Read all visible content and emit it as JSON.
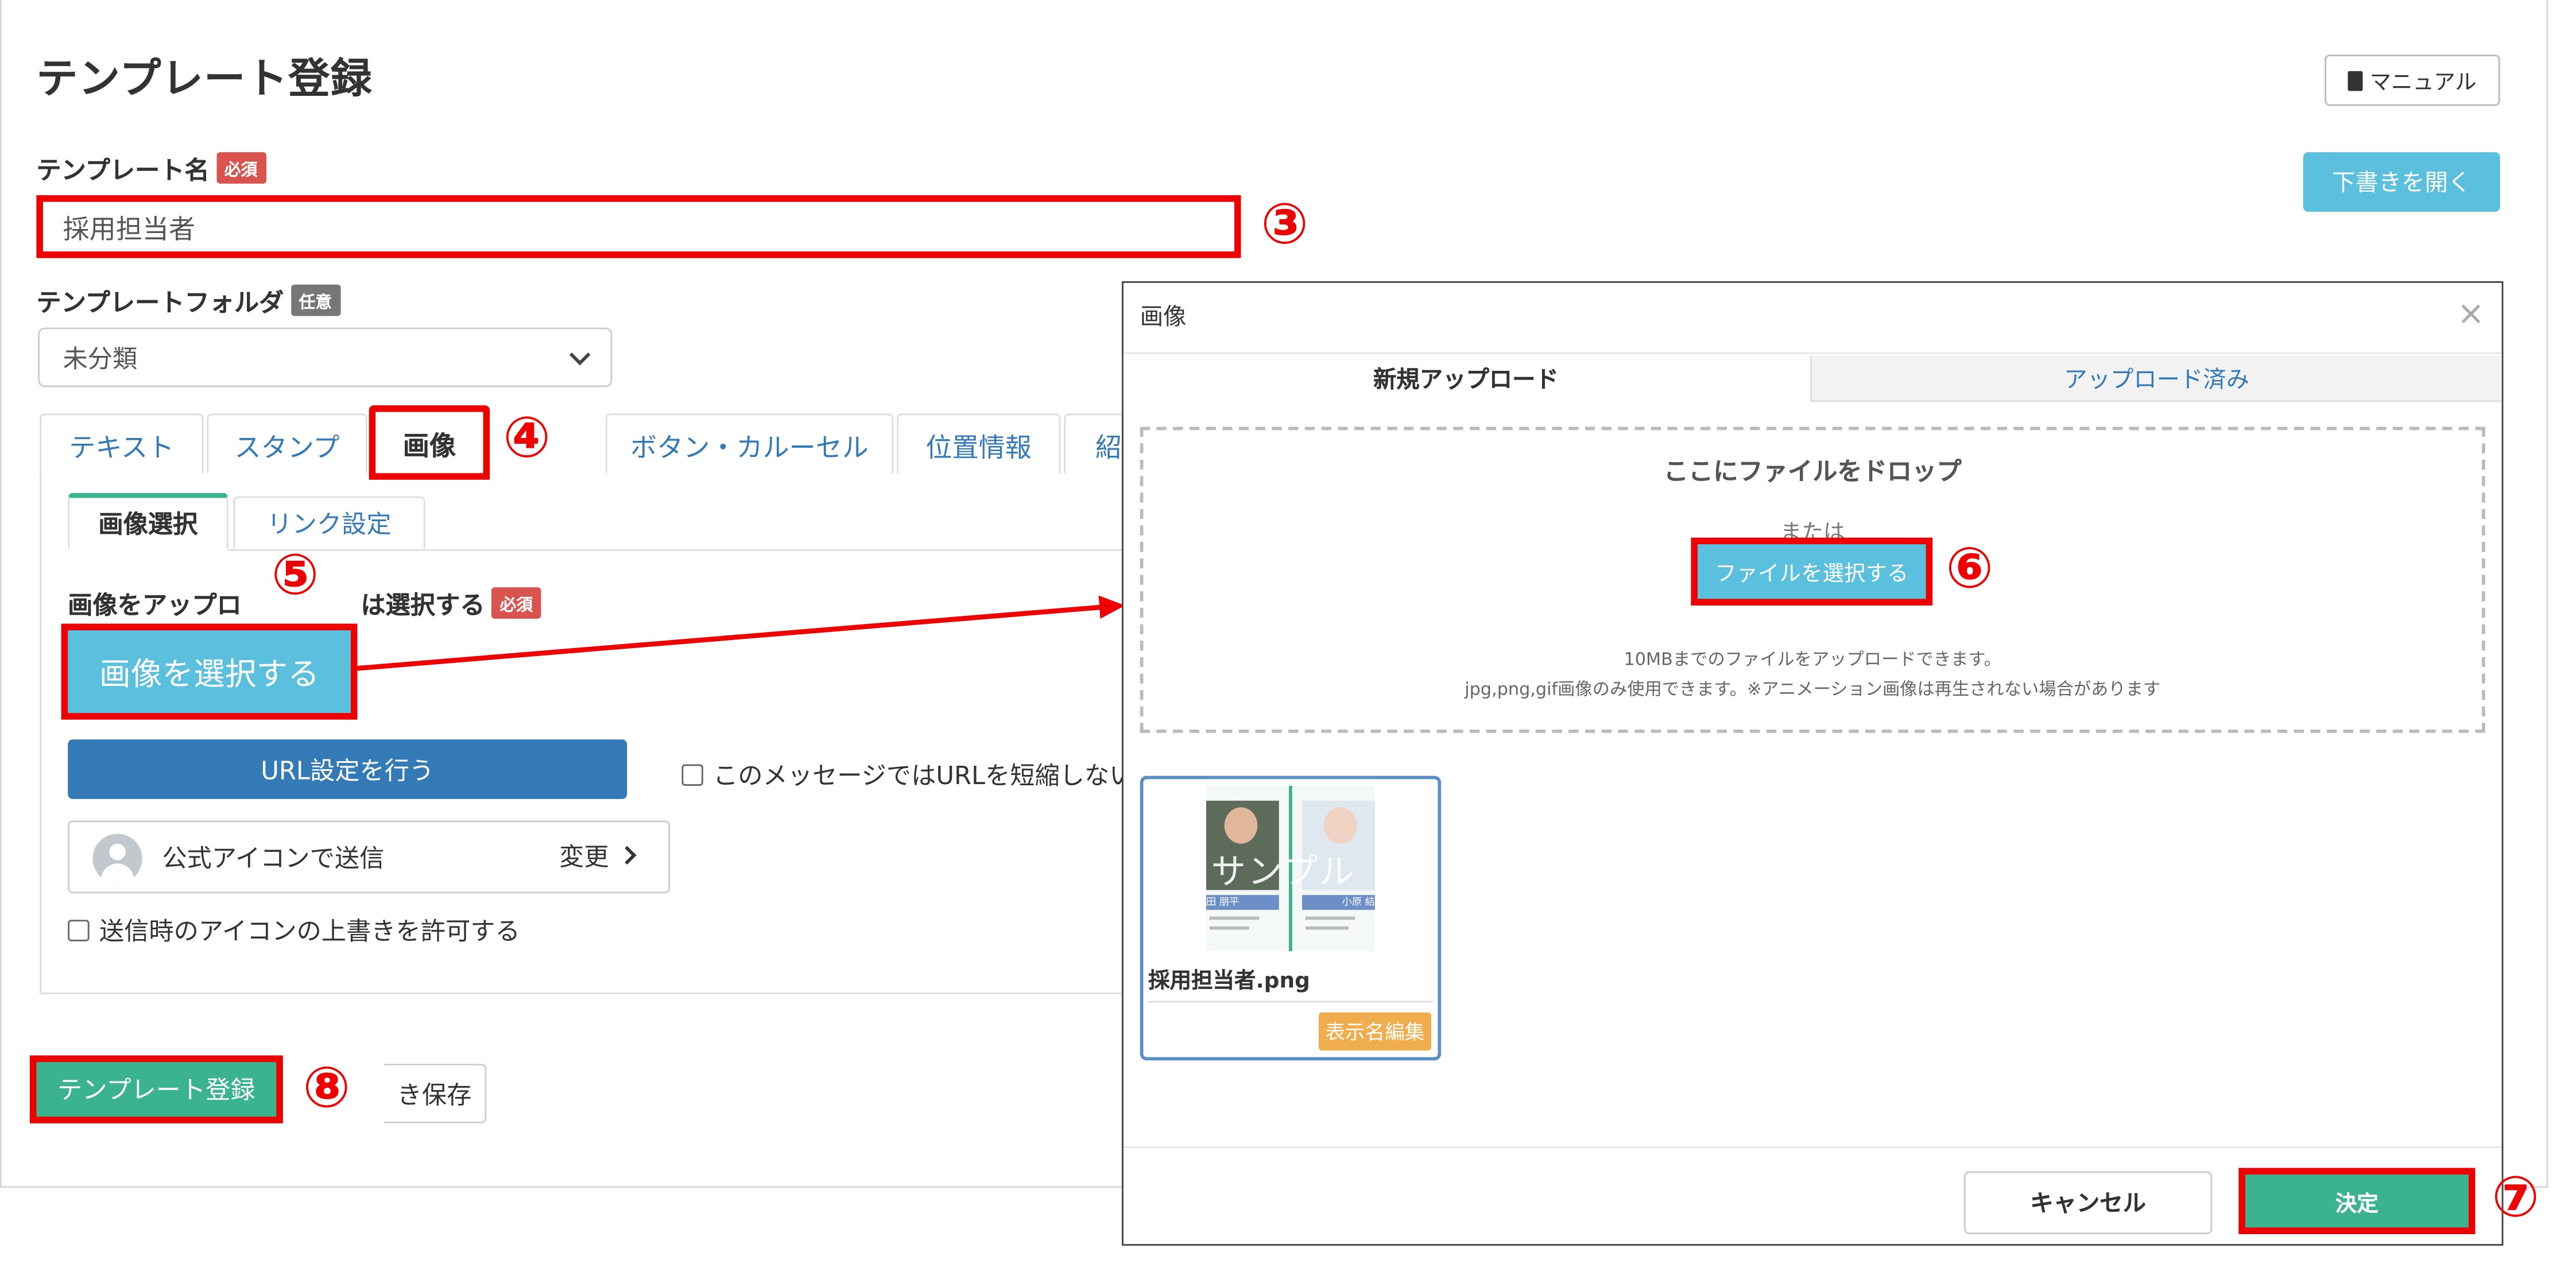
{
  "page": {
    "title": "テンプレート登録",
    "manual_label": "マニュアル",
    "open_draft_label": "下書きを開く"
  },
  "form": {
    "name_label": "テンプレート名",
    "required_badge": "必須",
    "name_value": "採用担当者",
    "folder_label": "テンプレートフォルダ",
    "optional_badge": "任意",
    "folder_value": "未分類"
  },
  "tabs": [
    {
      "label": "テキスト"
    },
    {
      "label": "スタンプ"
    },
    {
      "label": "画像"
    },
    {
      "label": "ボタン・カルーセル"
    },
    {
      "label": "位置情報"
    },
    {
      "label": "紹"
    }
  ],
  "subtabs": [
    {
      "label": "画像選択"
    },
    {
      "label": "リンク設定"
    }
  ],
  "image_panel": {
    "upload_label_part1": "画像をアップロ",
    "upload_label_part2": "は選択する",
    "required_badge": "必須",
    "select_image_label": "画像を選択する",
    "url_setting_label": "URL設定を行う",
    "no_shorten_label": "このメッセージではURLを短縮しない",
    "official_icon_label": "公式アイコンで送信",
    "change_label": "変更",
    "override_label": "送信時のアイコンの上書きを許可する"
  },
  "footer": {
    "register_label": "テンプレート登録",
    "save_label": "き保存"
  },
  "modal": {
    "title": "画像",
    "close": "×",
    "tabs": [
      {
        "label": "新規アップロード"
      },
      {
        "label": "アップロード済み"
      }
    ],
    "drop_title": "ここにファイルをドロップ",
    "or_label": "または",
    "choose_file_label": "ファイルを選択する",
    "note_line1": "10MBまでのファイルをアップロードできます。",
    "note_line2": "jpg,png,gif画像のみ使用できます。※アニメーション画像は再生されない場合があります",
    "thumb_watermark": "サンプル",
    "thumb_name1": "田 朋平",
    "thumb_name2": "小原 結",
    "file_name": "採用担当者.png",
    "edit_name_label": "表示名編集",
    "cancel_label": "キャンセル",
    "ok_label": "決定"
  },
  "annotations": {
    "n3": "③",
    "n4": "④",
    "n5": "⑤",
    "n6": "⑥",
    "n7": "⑦",
    "n8": "⑧"
  },
  "colors": {
    "highlight": "#ee0000",
    "info": "#5bc0de",
    "primary": "#337ab7",
    "success": "#3bb38f",
    "warning": "#f0ad4e",
    "danger": "#d9534f"
  }
}
